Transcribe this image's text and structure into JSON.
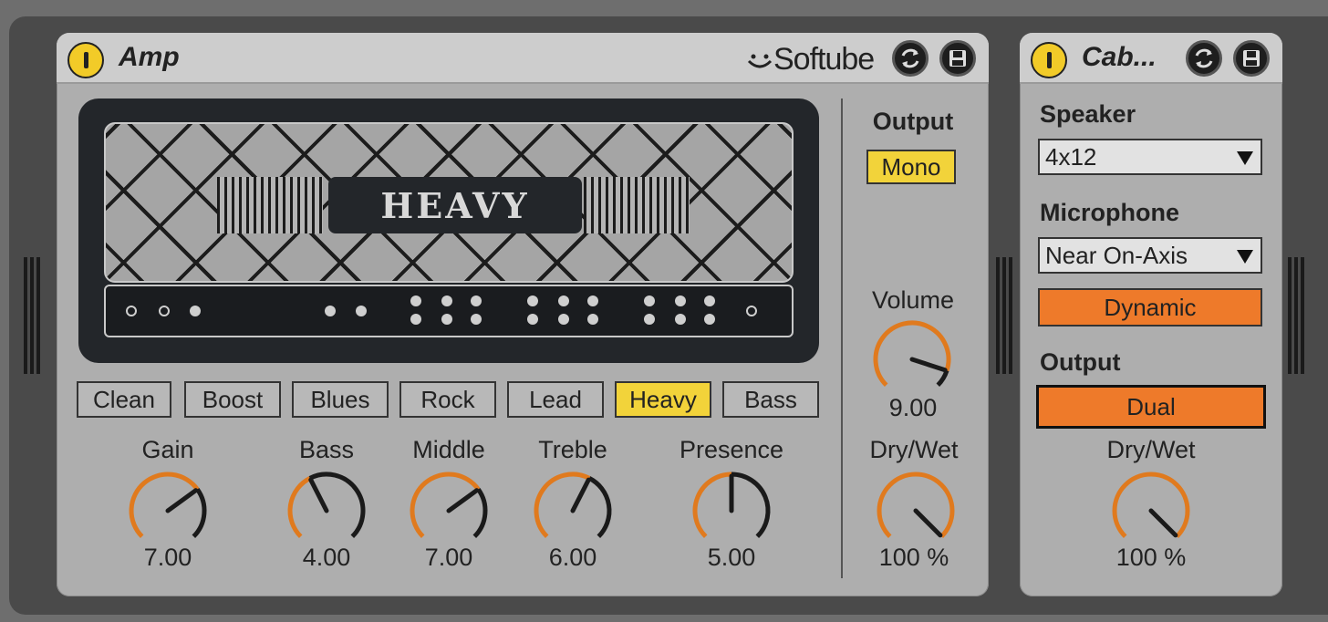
{
  "colors": {
    "accent_yellow": "#f2d33a",
    "accent_orange": "#ee7a2a",
    "knob_arc": "#e07a1e",
    "panel": "#aeaeae",
    "titlebar": "#cdcdcd"
  },
  "amp": {
    "title": "Amp",
    "brand": "Softube",
    "hot_swap_icon": "hot-swap-icon",
    "save_icon": "save-preset-icon",
    "display_name": "HEAVY",
    "presets": [
      {
        "label": "Clean",
        "active": false
      },
      {
        "label": "Boost",
        "active": false
      },
      {
        "label": "Blues",
        "active": false
      },
      {
        "label": "Rock",
        "active": false
      },
      {
        "label": "Lead",
        "active": false
      },
      {
        "label": "Heavy",
        "active": true
      },
      {
        "label": "Bass",
        "active": false
      }
    ],
    "knobs": [
      {
        "label": "Gain",
        "value": "7.00",
        "fraction": 0.7
      },
      {
        "label": "Bass",
        "value": "4.00",
        "fraction": 0.4
      },
      {
        "label": "Middle",
        "value": "7.00",
        "fraction": 0.7
      },
      {
        "label": "Treble",
        "value": "6.00",
        "fraction": 0.6
      },
      {
        "label": "Presence",
        "value": "5.00",
        "fraction": 0.5
      }
    ],
    "output_label": "Output",
    "output_mode": "Mono",
    "volume": {
      "label": "Volume",
      "value": "9.00",
      "fraction": 0.9
    },
    "drywet": {
      "label": "Dry/Wet",
      "value": "100 %",
      "fraction": 1.0
    }
  },
  "cabinet": {
    "title": "Cab...",
    "speaker_label": "Speaker",
    "speaker_value": "4x12",
    "microphone_label": "Microphone",
    "microphone_value": "Near On-Axis",
    "mic_mode": "Dynamic",
    "output_label": "Output",
    "output_mode": "Dual",
    "drywet": {
      "label": "Dry/Wet",
      "value": "100 %",
      "fraction": 1.0
    }
  }
}
